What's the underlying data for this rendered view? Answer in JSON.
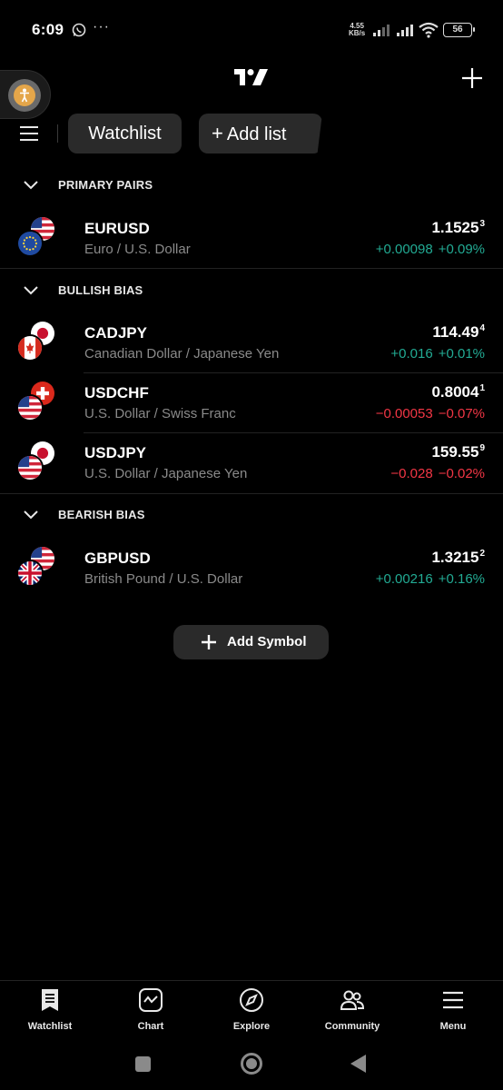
{
  "status_bar": {
    "time": "6:09",
    "dots": "···",
    "net_speed_value": "4.55",
    "net_speed_unit": "KB/s",
    "battery": "56"
  },
  "header": {
    "watchlist_tab": "Watchlist",
    "add_list_plus": "+",
    "add_list_label": "Add list"
  },
  "sections": [
    {
      "title": "PRIMARY PAIRS",
      "rows": [
        {
          "symbol": "EURUSD",
          "description": "Euro / U.S. Dollar",
          "price": "1.1525",
          "price_super": "3",
          "change": "+0.00098",
          "change_pct": "+0.09%",
          "direction": "up",
          "flags": [
            "us-flag-icon",
            "eu-flag-icon"
          ]
        }
      ]
    },
    {
      "title": "BULLISH BIAS",
      "rows": [
        {
          "symbol": "CADJPY",
          "description": "Canadian Dollar / Japanese Yen",
          "price": "114.49",
          "price_super": "4",
          "change": "+0.016",
          "change_pct": "+0.01%",
          "direction": "up",
          "flags": [
            "jp-flag-icon",
            "ca-flag-icon"
          ]
        },
        {
          "symbol": "USDCHF",
          "description": "U.S. Dollar / Swiss Franc",
          "price": "0.8004",
          "price_super": "1",
          "change": "−0.00053",
          "change_pct": "−0.07%",
          "direction": "down",
          "flags": [
            "ch-flag-icon",
            "us-flag-icon"
          ]
        },
        {
          "symbol": "USDJPY",
          "description": "U.S. Dollar / Japanese Yen",
          "price": "159.55",
          "price_super": "9",
          "change": "−0.028",
          "change_pct": "−0.02%",
          "direction": "down",
          "flags": [
            "jp-flag-icon",
            "us-flag-icon"
          ]
        }
      ]
    },
    {
      "title": "BEARISH BIAS",
      "rows": [
        {
          "symbol": "GBPUSD",
          "description": "British Pound / U.S. Dollar",
          "price": "1.3215",
          "price_super": "2",
          "change": "+0.00216",
          "change_pct": "+0.16%",
          "direction": "up",
          "flags": [
            "us-flag-icon",
            "uk-flag-icon"
          ]
        }
      ]
    }
  ],
  "add_symbol": {
    "label": "Add Symbol"
  },
  "bottom_nav": [
    {
      "label": "Watchlist",
      "icon": "watchlist-icon"
    },
    {
      "label": "Chart",
      "icon": "chart-icon"
    },
    {
      "label": "Explore",
      "icon": "compass-icon"
    },
    {
      "label": "Community",
      "icon": "community-icon"
    },
    {
      "label": "Menu",
      "icon": "menu-icon"
    }
  ],
  "colors": {
    "up": "#22ab94",
    "down": "#f23645",
    "background": "#000000",
    "chip": "#2a2a2a"
  }
}
